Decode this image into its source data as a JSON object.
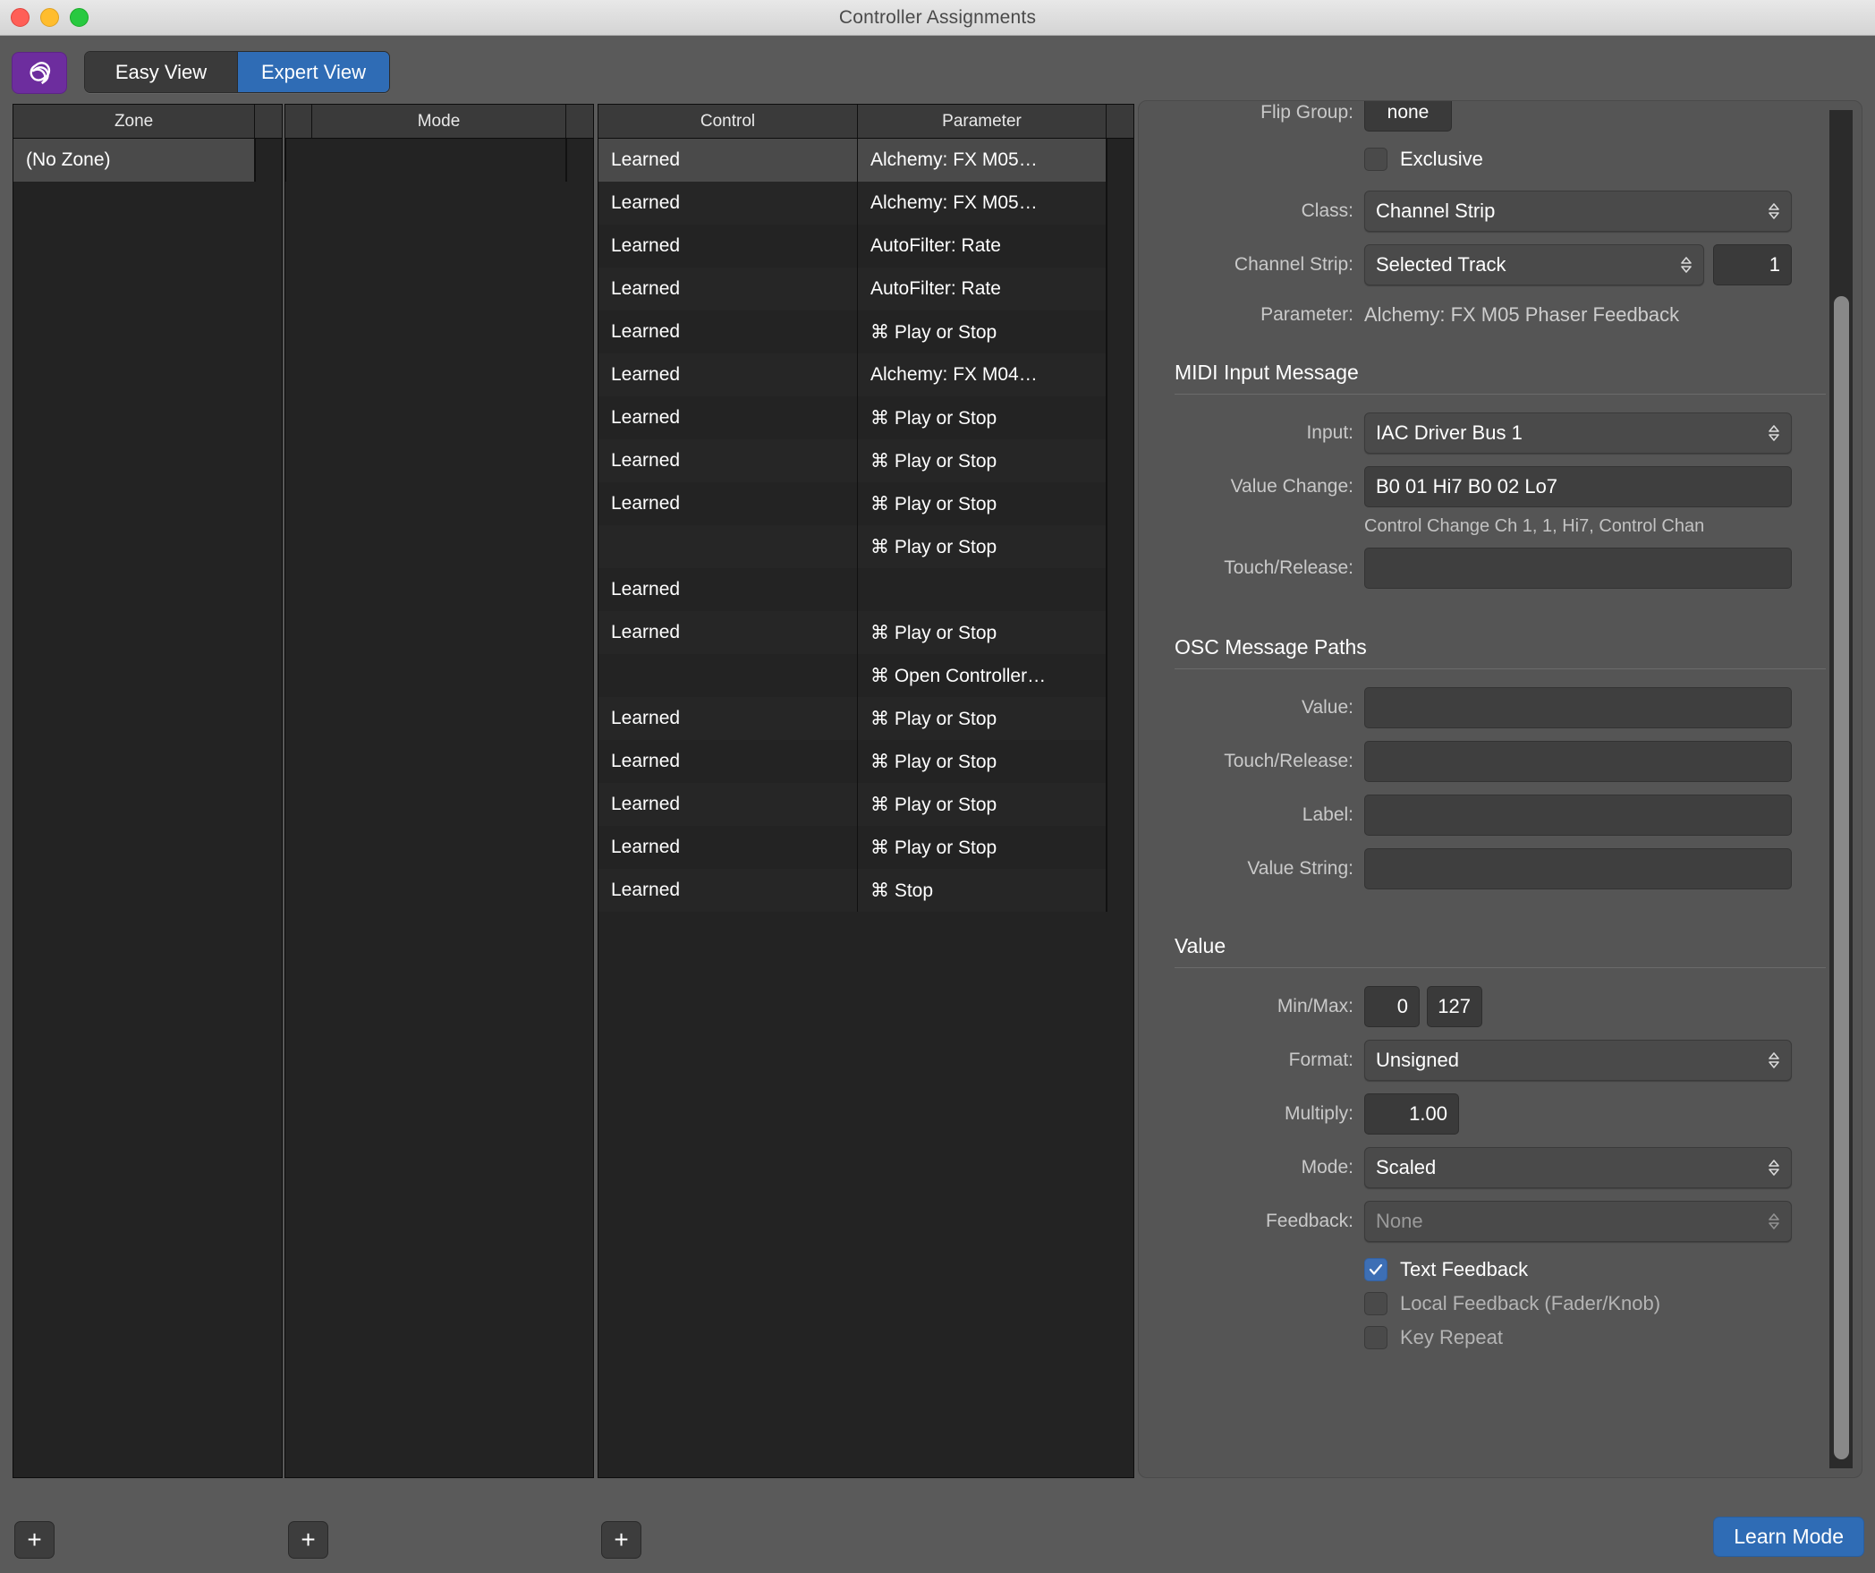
{
  "window": {
    "title": "Controller Assignments"
  },
  "toolbar": {
    "link_icon": "link-chain-icon",
    "views": [
      {
        "label": "Easy View",
        "active": false
      },
      {
        "label": "Expert View",
        "active": true
      }
    ]
  },
  "tables": {
    "zone": {
      "header": "Zone",
      "rows": [
        {
          "name": "(No Zone)",
          "selected": true
        }
      ]
    },
    "mode": {
      "header": "Mode",
      "rows": []
    },
    "assignments": {
      "headers": [
        "Control",
        "Parameter"
      ],
      "rows": [
        {
          "control": "Learned",
          "parameter": "Alchemy: FX M05…",
          "selected": true
        },
        {
          "control": "Learned",
          "parameter": "Alchemy: FX M05…",
          "selected": false
        },
        {
          "control": "Learned",
          "parameter": "AutoFilter: Rate",
          "selected": false
        },
        {
          "control": "Learned",
          "parameter": "AutoFilter: Rate",
          "selected": false
        },
        {
          "control": "Learned",
          "parameter": "⌘ Play or Stop",
          "selected": false
        },
        {
          "control": "Learned",
          "parameter": "Alchemy: FX M04…",
          "selected": false
        },
        {
          "control": "Learned",
          "parameter": "⌘ Play or Stop",
          "selected": false
        },
        {
          "control": "Learned",
          "parameter": "⌘ Play or Stop",
          "selected": false
        },
        {
          "control": "Learned",
          "parameter": "⌘ Play or Stop",
          "selected": false
        },
        {
          "control": "",
          "parameter": "⌘ Play or Stop",
          "selected": false
        },
        {
          "control": "Learned",
          "parameter": "",
          "selected": false
        },
        {
          "control": "Learned",
          "parameter": "⌘ Play or Stop",
          "selected": false
        },
        {
          "control": "",
          "parameter": "⌘ Open Controller…",
          "selected": false
        },
        {
          "control": "Learned",
          "parameter": "⌘ Play or Stop",
          "selected": false
        },
        {
          "control": "Learned",
          "parameter": "⌘ Play or Stop",
          "selected": false
        },
        {
          "control": "Learned",
          "parameter": "⌘ Play or Stop",
          "selected": false
        },
        {
          "control": "Learned",
          "parameter": "⌘ Play or Stop",
          "selected": false
        },
        {
          "control": "Learned",
          "parameter": "⌘ Stop",
          "selected": false
        }
      ]
    }
  },
  "add_buttons": {
    "zone_add": "+",
    "mode_add": "+",
    "assignment_add": "+"
  },
  "inspector": {
    "flip_group": {
      "label": "Flip Group:",
      "value": "none"
    },
    "exclusive": {
      "label": "Exclusive",
      "checked": false
    },
    "class": {
      "label": "Class:",
      "value": "Channel Strip"
    },
    "channel_strip": {
      "label": "Channel Strip:",
      "value": "Selected Track",
      "index": "1"
    },
    "parameter": {
      "label": "Parameter:",
      "value": "Alchemy: FX M05 Phaser Feedback"
    },
    "midi_input_message": {
      "title": "MIDI Input Message",
      "input": {
        "label": "Input:",
        "value": "IAC Driver Bus 1"
      },
      "value_change": {
        "label": "Value Change:",
        "value": "B0 01 Hi7 B0 02 Lo7"
      },
      "value_change_hint": "Control Change Ch 1, 1, Hi7, Control Chan",
      "touch_release": {
        "label": "Touch/Release:",
        "value": ""
      }
    },
    "osc_message_paths": {
      "title": "OSC Message Paths",
      "value": {
        "label": "Value:",
        "value": ""
      },
      "touch_release": {
        "label": "Touch/Release:",
        "value": ""
      },
      "label_field": {
        "label": "Label:",
        "value": ""
      },
      "value_string": {
        "label": "Value String:",
        "value": ""
      }
    },
    "value": {
      "title": "Value",
      "minmax": {
        "label": "Min/Max:",
        "min": "0",
        "max": "127"
      },
      "format": {
        "label": "Format:",
        "value": "Unsigned"
      },
      "multiply": {
        "label": "Multiply:",
        "value": "1.00"
      },
      "mode": {
        "label": "Mode:",
        "value": "Scaled"
      },
      "feedback": {
        "label": "Feedback:",
        "value": "None"
      },
      "text_feedback": {
        "label": "Text Feedback",
        "checked": true
      },
      "local_feedback": {
        "label": "Local Feedback (Fader/Knob)",
        "checked": false
      },
      "key_repeat": {
        "label": "Key Repeat",
        "checked": false
      }
    }
  },
  "footer": {
    "learn_mode": "Learn Mode"
  },
  "colors": {
    "accent_blue": "#2f6cb5",
    "link_purple": "#6d2d9e",
    "window_bg": "#5a5a5a",
    "table_bg": "#232323",
    "inspector_bg": "#555555"
  }
}
